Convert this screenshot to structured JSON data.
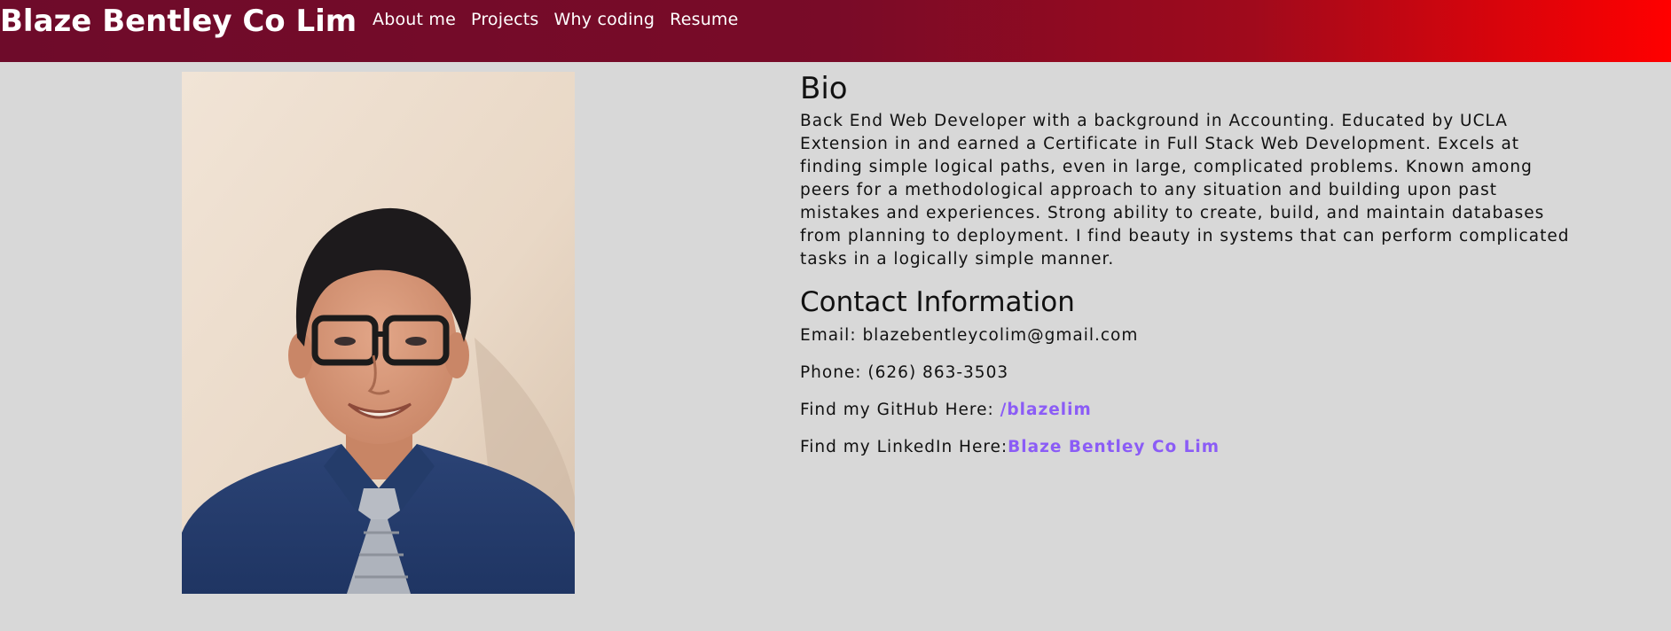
{
  "header": {
    "brand": "Blaze Bentley Co Lim",
    "nav": [
      {
        "label": "About me"
      },
      {
        "label": "Projects"
      },
      {
        "label": "Why coding"
      },
      {
        "label": "Resume"
      }
    ]
  },
  "bio": {
    "title": "Bio",
    "text": "Back End Web Developer with a background in Accounting. Educated by UCLA Extension in and earned a Certificate in Full Stack Web Development. Excels at finding simple logical paths, even in large, complicated problems. Known among peers for a methodological approach to any situation and building upon past mistakes and experiences. Strong ability to create, build, and maintain databases from planning to deployment. I find beauty in systems that can perform complicated tasks in a logically simple manner."
  },
  "contact": {
    "title": "Contact Information",
    "email": "Email: blazebentleycolim@gmail.com",
    "phone": "Phone: (626) 863-3503",
    "github_label": "Find my GitHub Here:",
    "github_link": "/blazelim",
    "linkedin_label": "Find my LinkedIn Here:",
    "linkedin_link": "Blaze Bentley Co Lim"
  },
  "colors": {
    "header_start": "#6e0b2a",
    "header_end": "#ff0000",
    "page_background": "#d8d8d8",
    "link": "#8b5cf6"
  },
  "icons": {
    "profile_photo": "profile-photo"
  }
}
